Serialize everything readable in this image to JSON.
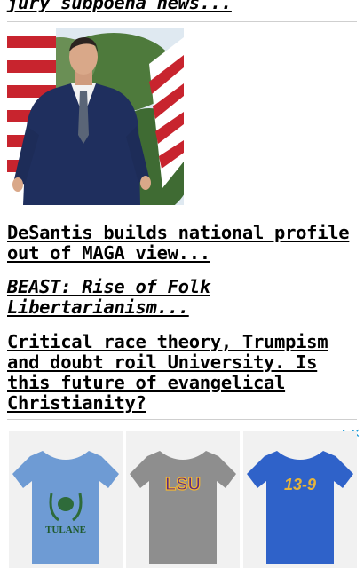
{
  "articles": [
    {
      "headline": "jury subpoena news..."
    },
    {
      "headline": "DeSantis builds national profile out of MAGA view..."
    },
    {
      "headline": "BEAST: Rise of Folk Libertarianism..."
    },
    {
      "headline": "Critical race theory, Trumpism and doubt roil University. Is this future of evangelical Christianity?"
    }
  ],
  "ad": {
    "choices_icon": "adchoices-triangle-icon",
    "close_icon": "close-x-icon",
    "products": [
      {
        "label": "TULANE",
        "shirt_color": "#6e9bd4"
      },
      {
        "label": "LSU",
        "shirt_color": "#8e8e8e"
      },
      {
        "label": "13-9",
        "shirt_color": "#2f62c9"
      }
    ]
  },
  "colors": {
    "link": "#000000",
    "ad_accent": "#1a9ad8"
  }
}
